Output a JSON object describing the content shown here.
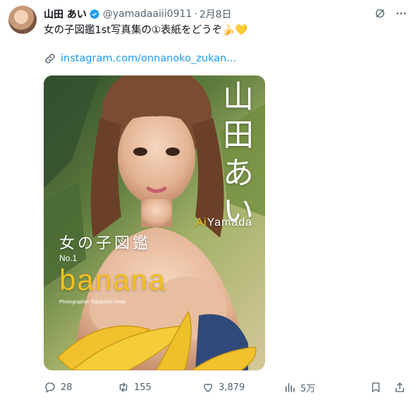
{
  "tweet": {
    "author_name": "山田 あい",
    "handle": "@yamadaaiii0911",
    "separator": "·",
    "date": "2月8日",
    "text": "女の子図鑑1st写真集の①表紙をどうぞ🍌💛",
    "link_text": "instagram.com/onnanoko_zukan..."
  },
  "cover": {
    "vertical_name": "山田あい",
    "roman_prefix": "Ai",
    "roman_suffix": "Yamada",
    "series": "女の子図鑑",
    "number": "No.1",
    "title": "banana",
    "photographer": "Photographer Takayoshi Ueda"
  },
  "actions": {
    "replies": "28",
    "retweets": "155",
    "likes": "3,879",
    "views": "5万"
  },
  "icons": {
    "verified": "verified-badge-icon",
    "grok": "grok-icon",
    "more": "more-icon",
    "link": "link-icon",
    "reply": "reply-icon",
    "retweet": "retweet-icon",
    "like": "heart-icon",
    "views": "views-icon",
    "bookmark": "bookmark-icon",
    "share": "share-icon"
  },
  "colors": {
    "accent": "#1d9bf0",
    "text": "#0f1419",
    "muted": "#536471",
    "cover_title": "#f3c020"
  }
}
